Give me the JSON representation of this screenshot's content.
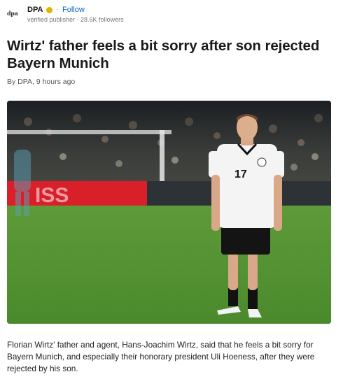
{
  "publisher": {
    "logo_text": "dpa",
    "name": "DPA",
    "verified_icon": "verified-badge-icon",
    "separator": "·",
    "follow_label": "Follow",
    "meta": "verified publisher · 28.6K followers",
    "colors": {
      "follow": "#0c64c8",
      "verified": "#e2b400"
    }
  },
  "article": {
    "headline": "Wirtz' father feels a bit sorry after son rejected Bayern Munich",
    "byline": "By DPA, 9 hours ago",
    "hero_image": {
      "jersey_number": "17",
      "banner_text": "ISS"
    },
    "lead": "Florian Wirtz' father and agent, Hans-Joachim Wirtz, said that he feels a bit sorry for Bayern Munich, and especially their honorary president Uli Hoeness, after they were rejected by his son."
  }
}
